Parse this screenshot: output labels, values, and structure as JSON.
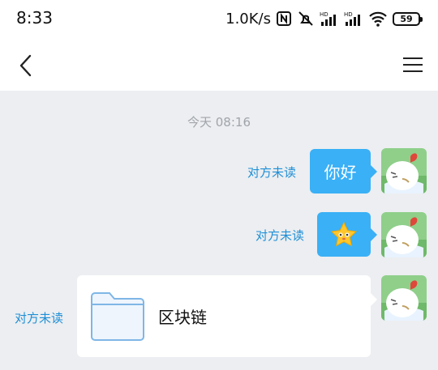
{
  "status_bar": {
    "time": "8:33",
    "net_speed": "1.0K/s",
    "signal_label": "HD",
    "battery": "59"
  },
  "nav": {
    "back_icon": "chevron-left-icon",
    "menu_icon": "hamburger-menu-icon"
  },
  "chat": {
    "timestamp": "今天 08:16",
    "messages": [
      {
        "type": "text",
        "text": "你好",
        "status": "对方未读"
      },
      {
        "type": "emoji",
        "emoji": "yellow-star-emoji",
        "status": "对方未读"
      },
      {
        "type": "file",
        "file_name": "区块链",
        "status": "对方未读"
      }
    ]
  },
  "colors": {
    "bubble": "#3ab0f6",
    "unread": "#1f8fd6",
    "background": "#eceef1"
  }
}
